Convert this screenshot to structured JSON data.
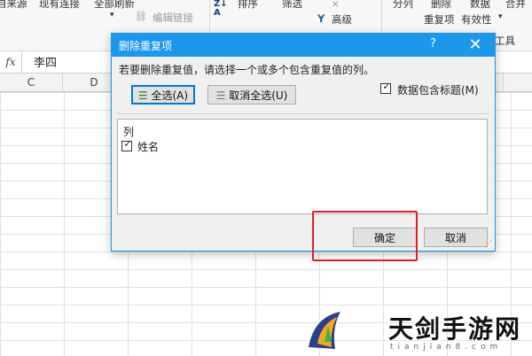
{
  "ribbon": {
    "from_source": "自来源",
    "existing_connections": "现有连接",
    "refresh_all": "全部刷新",
    "edit_links": "编辑链接",
    "sort_az": "Z↓ A",
    "sort": "排序",
    "filter": "筛选",
    "clear": "✕",
    "advanced": "高级",
    "text_to_columns": "分列",
    "remove_duplicates": "删除",
    "data_label": "数据",
    "merge": "合并",
    "dup_items": "重复项",
    "validity": "有效性",
    "tools": "工具",
    "question": "?"
  },
  "formula_bar": {
    "fx_label": "fx",
    "value": "李四"
  },
  "columns": [
    "C",
    "D"
  ],
  "dialog": {
    "title": "删除重复项",
    "help": "?",
    "close": "✕",
    "prompt": "若要删除重复值，请选择一个或多个包含重复值的列。",
    "select_all": "全选(A)",
    "unselect_all": "取消全选(U)",
    "has_headers_label": "数据包含标题(M)",
    "has_headers_checked": true,
    "list_header": "列",
    "items": [
      {
        "label": "姓名",
        "checked": true
      }
    ],
    "ok": "确定",
    "cancel": "取消"
  },
  "watermark": {
    "text": "天剑手游网",
    "sub": "tianjian8.com"
  },
  "colors": {
    "accent": "#1c97ea",
    "highlight": "#e02020"
  }
}
